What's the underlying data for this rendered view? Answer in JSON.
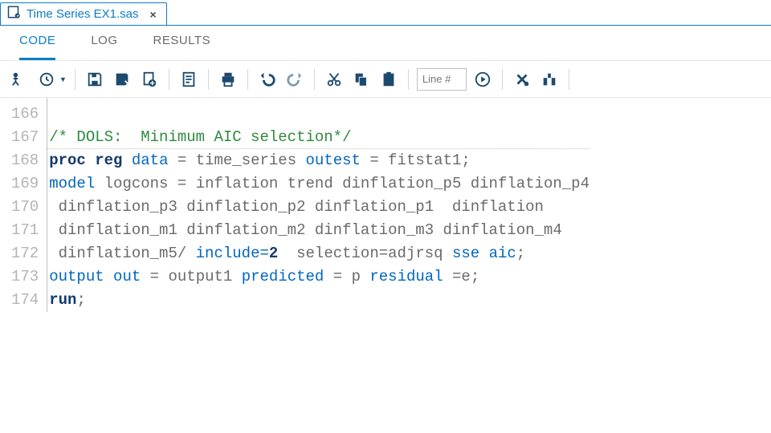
{
  "file_tab": {
    "label": "Time Series EX1.sas",
    "close": "×"
  },
  "view_tabs": {
    "code": "CODE",
    "log": "LOG",
    "results": "RESULTS",
    "active": "code"
  },
  "toolbar": {
    "line_placeholder": "Line #",
    "icons": {
      "run": "run-icon",
      "history": "history-icon",
      "save": "save-icon",
      "saveas": "saveas-icon",
      "export": "export-icon",
      "summary": "summary-icon",
      "print": "print-icon",
      "undo": "undo-icon",
      "redo": "redo-icon",
      "cut": "cut-icon",
      "copy": "copy-icon",
      "paste": "paste-icon",
      "goto": "goto-icon",
      "clear": "clear-icon",
      "format": "format-icon"
    }
  },
  "gutter": [
    "166",
    "167",
    "168",
    "169",
    "170",
    "171",
    "172",
    "173",
    "174"
  ],
  "code": {
    "l167_cmt": "/* DOLS:  Minimum AIC selection*/",
    "l168": {
      "proc": "proc",
      "reg": "reg",
      "data": "data",
      "eq": " = ",
      "ds": "time_series",
      "outest": "outest",
      "eq2": " = ",
      "out": "fitstat1",
      "semi": ";"
    },
    "l169": {
      "model": "model",
      "resp": "logcons",
      "eq": " = ",
      "rest": "inflation trend dinflation_p5 dinflation_p4"
    },
    "l170": " dinflation_p3 dinflation_p2 dinflation_p1  dinflation",
    "l171": " dinflation_m1 dinflation_m2 dinflation_m3 dinflation_m4",
    "l172": {
      "pre": " dinflation_m5/ ",
      "include": "include",
      "eq": "=",
      "n": "2",
      "gap": "  ",
      "sel": "selection=adjrsq ",
      "sse": "sse",
      "sp": " ",
      "aic": "aic",
      "semi": ";"
    },
    "l173": {
      "output": "output",
      "out": "out",
      "eq": " = ",
      "o1": "output1",
      "sp": " ",
      "pred": "predicted",
      "eq2": " = ",
      "p": "p ",
      "res": "residual",
      "eq3": " =",
      "e": "e",
      "semi": ";"
    },
    "l174": {
      "run": "run",
      "semi": ";"
    }
  }
}
